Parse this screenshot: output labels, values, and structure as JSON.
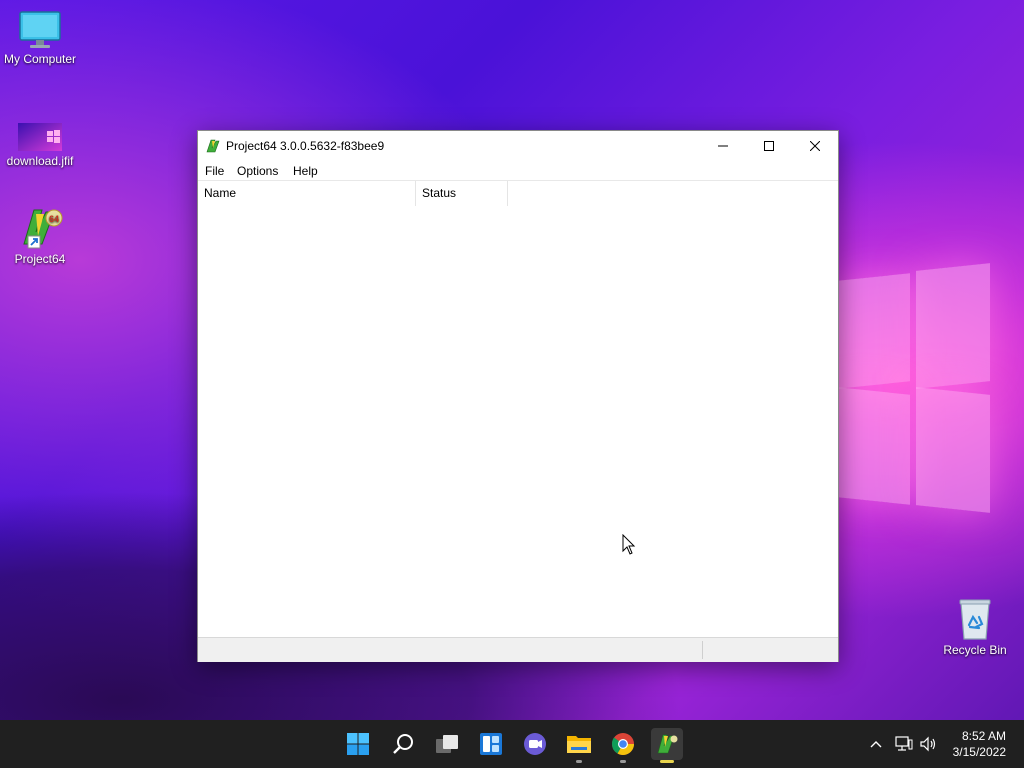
{
  "desktop": {
    "icons": [
      {
        "label": "My Computer"
      },
      {
        "label": "download.jfif"
      },
      {
        "label": "Project64"
      },
      {
        "label": "Recycle Bin"
      }
    ]
  },
  "window": {
    "title": "Project64 3.0.0.5632-f83bee9",
    "menu": [
      "File",
      "Options",
      "Help"
    ],
    "columns": [
      "Name",
      "Status"
    ]
  },
  "taskbar": {
    "apps": [
      "start-icon",
      "search-icon",
      "task-view-icon",
      "widgets-icon",
      "teams-chat-icon",
      "file-explorer-icon",
      "chrome-icon",
      "project64-icon"
    ],
    "clock": {
      "time": "8:52 AM",
      "date": "3/15/2022"
    }
  },
  "colors": {
    "accent": "#0078d4",
    "taskbar": "#202020",
    "running_indicator": "#e8d44d"
  }
}
